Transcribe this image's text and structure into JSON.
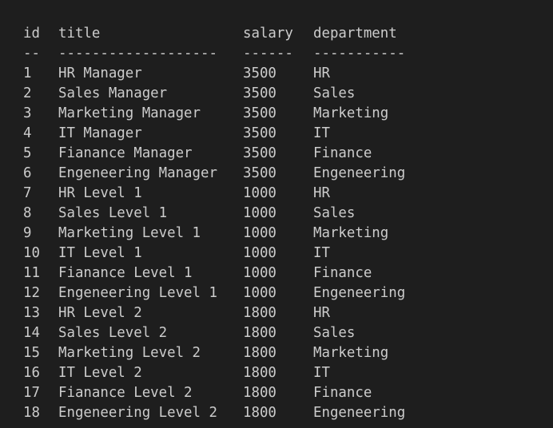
{
  "table": {
    "headers": {
      "id": "id",
      "title": "title",
      "salary": "salary",
      "department": "department"
    },
    "separators": {
      "id": "--",
      "title": "-------------------",
      "salary": "------",
      "department": "-----------"
    },
    "rows": [
      {
        "id": "1",
        "title": "HR Manager",
        "salary": "3500",
        "department": "HR"
      },
      {
        "id": "2",
        "title": "Sales Manager",
        "salary": "3500",
        "department": "Sales"
      },
      {
        "id": "3",
        "title": "Marketing Manager",
        "salary": "3500",
        "department": "Marketing"
      },
      {
        "id": "4",
        "title": "IT Manager",
        "salary": "3500",
        "department": "IT"
      },
      {
        "id": "5",
        "title": "Fianance Manager",
        "salary": "3500",
        "department": "Finance"
      },
      {
        "id": "6",
        "title": "Engeneering Manager",
        "salary": "3500",
        "department": "Engeneering"
      },
      {
        "id": "7",
        "title": "HR Level 1",
        "salary": "1000",
        "department": "HR"
      },
      {
        "id": "8",
        "title": "Sales Level 1",
        "salary": "1000",
        "department": "Sales"
      },
      {
        "id": "9",
        "title": "Marketing Level 1",
        "salary": "1000",
        "department": "Marketing"
      },
      {
        "id": "10",
        "title": "IT Level 1",
        "salary": "1000",
        "department": "IT"
      },
      {
        "id": "11",
        "title": "Fianance Level 1",
        "salary": "1000",
        "department": "Finance"
      },
      {
        "id": "12",
        "title": "Engeneering Level 1",
        "salary": "1000",
        "department": "Engeneering"
      },
      {
        "id": "13",
        "title": "HR Level 2",
        "salary": "1800",
        "department": "HR"
      },
      {
        "id": "14",
        "title": "Sales Level 2",
        "salary": "1800",
        "department": "Sales"
      },
      {
        "id": "15",
        "title": "Marketing Level 2",
        "salary": "1800",
        "department": "Marketing"
      },
      {
        "id": "16",
        "title": "IT Level 2",
        "salary": "1800",
        "department": "IT"
      },
      {
        "id": "17",
        "title": "Fianance Level 2",
        "salary": "1800",
        "department": "Finance"
      },
      {
        "id": "18",
        "title": "Engeneering Level 2",
        "salary": "1800",
        "department": "Engeneering"
      }
    ]
  }
}
